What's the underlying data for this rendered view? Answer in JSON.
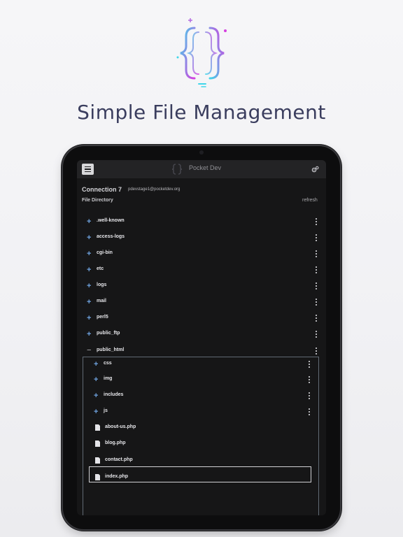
{
  "headline": "Simple File Management",
  "app": {
    "title": "Pocket Dev"
  },
  "connection": {
    "name": "Connection 7",
    "email": "pdevstage1@pocketdev.org"
  },
  "directory": {
    "label": "File Directory",
    "refresh_label": "refresh"
  },
  "folders": [
    {
      "name": ".well-known"
    },
    {
      "name": "access-logs"
    },
    {
      "name": "cgi-bin"
    },
    {
      "name": "etc"
    },
    {
      "name": "logs"
    },
    {
      "name": "mail"
    },
    {
      "name": "perl5"
    },
    {
      "name": "public_ftp"
    }
  ],
  "expanded_folder": {
    "name": "public_html",
    "subfolders": [
      {
        "name": "css"
      },
      {
        "name": "img"
      },
      {
        "name": "includes"
      },
      {
        "name": "js"
      }
    ],
    "files": [
      {
        "name": "about-us.php"
      },
      {
        "name": "blog.php"
      },
      {
        "name": "contact.php",
        "selected": true
      },
      {
        "name": "index.php"
      }
    ]
  },
  "colors": {
    "background": "#f3f3f6",
    "headline": "#3a3d5e",
    "screen": "#161617",
    "topbar": "#232325",
    "plus_icon": "#6fa3e0",
    "logo_gradient_start": "#3fd6ea",
    "logo_gradient_end": "#d63fe0"
  },
  "icons": {
    "logo": "curly-braces-icon",
    "menu": "hamburger-icon",
    "settings": "gears-icon",
    "expand": "plus-icon",
    "collapse": "minus-icon",
    "more": "kebab-icon",
    "file": "file-icon"
  }
}
